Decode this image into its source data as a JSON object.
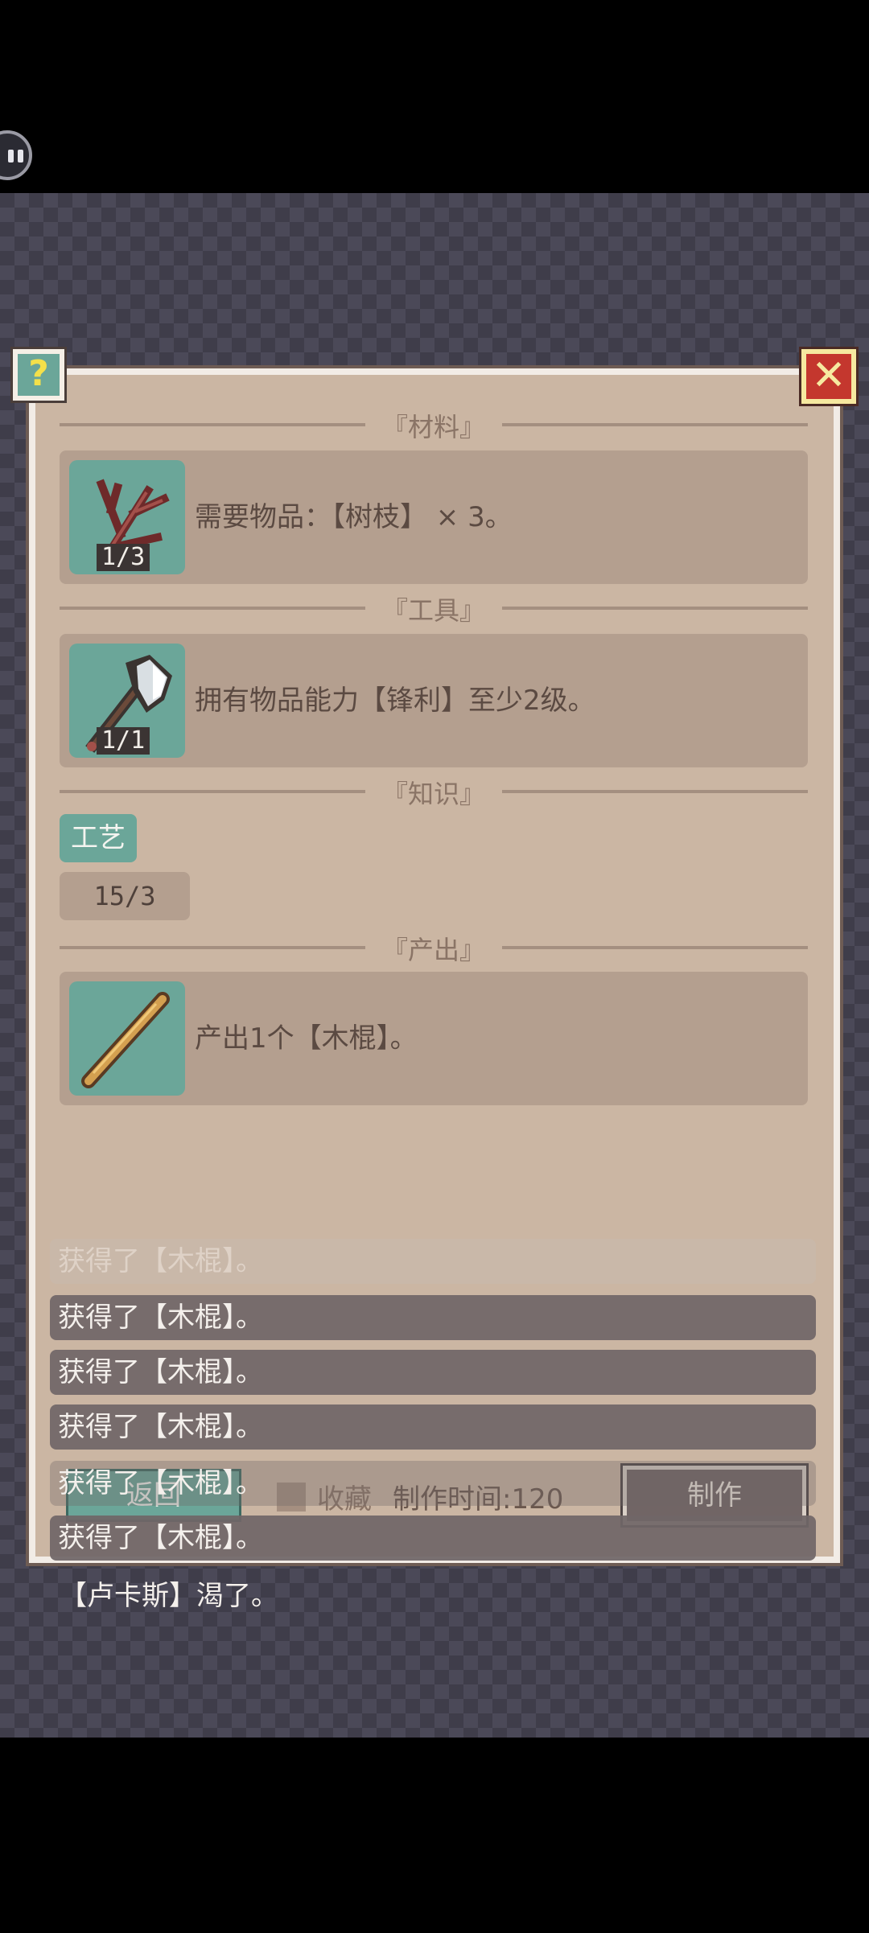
{
  "header": {
    "help_label": "?",
    "close_label": "✕"
  },
  "sections": {
    "materials_title": "『材料』",
    "tools_title": "『工具』",
    "knowledge_title": "『知识』",
    "output_title": "『产出』"
  },
  "materials": {
    "icon": "branch-icon",
    "count": "1/3",
    "text": "需要物品：【树枝】 × 3。"
  },
  "tools": {
    "icon": "axe-icon",
    "count": "1/1",
    "text": "拥有物品能力【锋利】至少2级。"
  },
  "knowledge": {
    "tag": "工艺",
    "level": "15/3"
  },
  "output": {
    "icon": "wooden-stick-icon",
    "text": "产出1个【木棍】。"
  },
  "footer": {
    "return_label": "返回",
    "favorite_label": "收藏",
    "craft_time": "制作时间:120",
    "make_label": "制作"
  },
  "log": {
    "faded_line": "获得了【木棍】。",
    "lines": [
      "获得了【木棍】。",
      "获得了【木棍】。",
      "获得了【木棍】。",
      "获得了【木棍】。",
      "获得了【木棍】。"
    ],
    "status": "【卢卡斯】渴了。"
  },
  "colors": {
    "panel": "#cbb6a3",
    "row": "#b49f8f",
    "icon_bg": "#6ba699",
    "close": "#c4372e",
    "help_mark": "#f4e04a"
  }
}
